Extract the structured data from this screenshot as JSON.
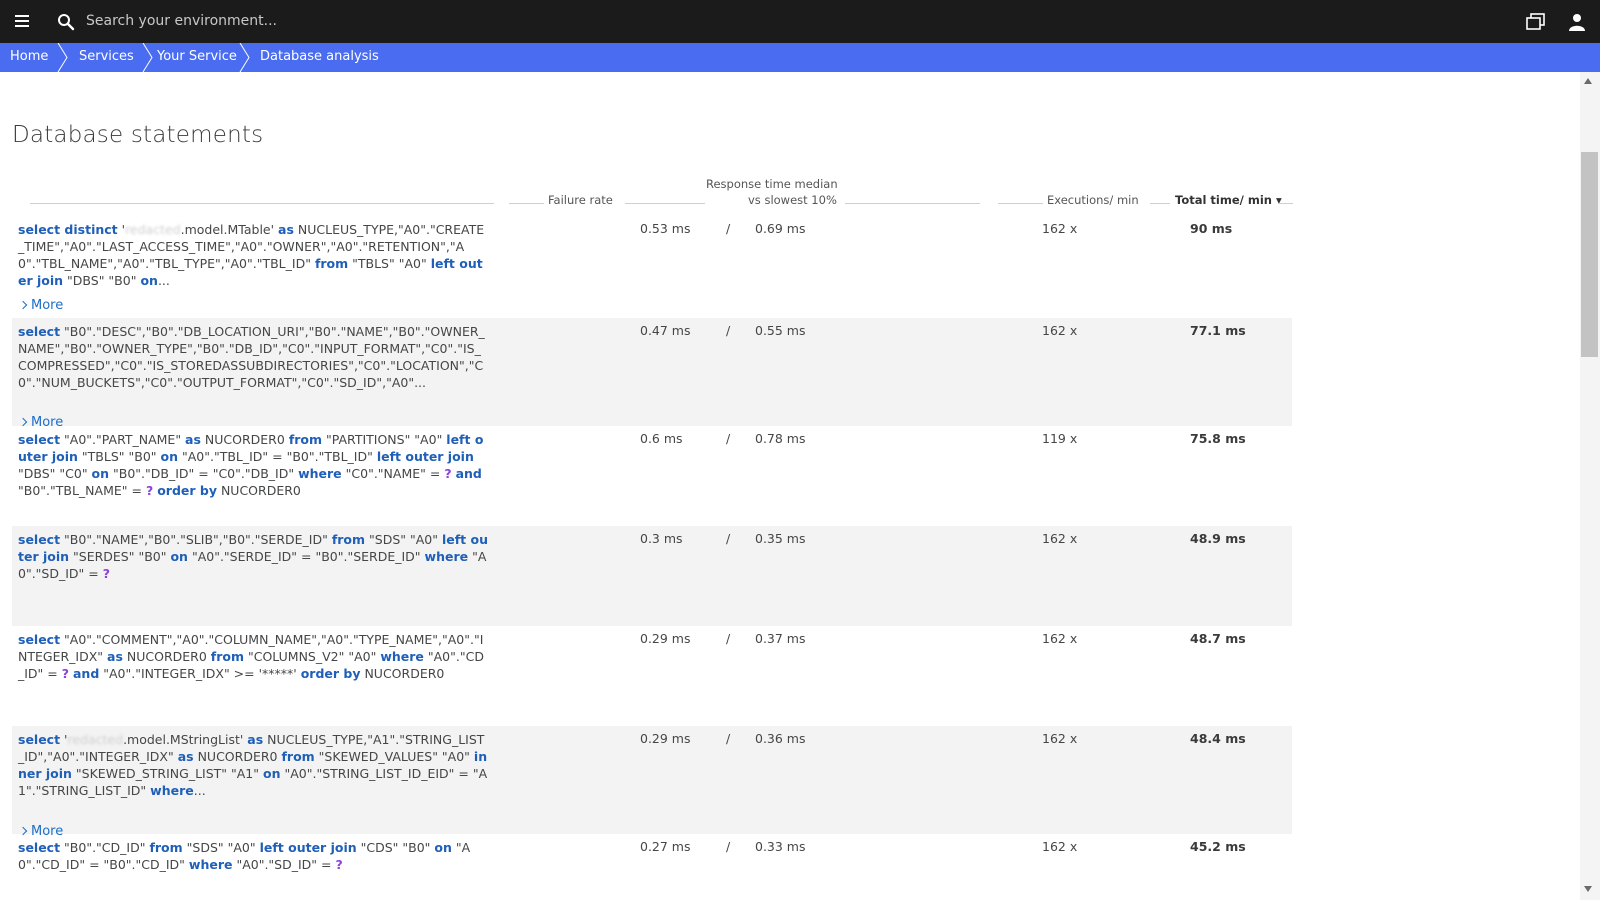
{
  "topbar": {
    "search_placeholder": "Search your environment..."
  },
  "breadcrumb": [
    "Home",
    "Services",
    "Your Service",
    "Database analysis"
  ],
  "page_title": "Database statements",
  "columns": {
    "failure_rate": "Failure rate",
    "response_line1": "Response time median",
    "response_line2": "vs slowest 10%",
    "executions": "Executions/ min",
    "total_time": "Total time/ min ▾"
  },
  "more_label": "More",
  "rows": [
    {
      "median": "0.53 ms",
      "sep": "/",
      "slowest": "0.69 ms",
      "executions": "162 x",
      "total": "90 ms"
    },
    {
      "median": "0.47 ms",
      "sep": "/",
      "slowest": "0.55 ms",
      "executions": "162 x",
      "total": "77.1 ms"
    },
    {
      "median": "0.6 ms",
      "sep": "/",
      "slowest": "0.78 ms",
      "executions": "119 x",
      "total": "75.8 ms"
    },
    {
      "median": "0.3 ms",
      "sep": "/",
      "slowest": "0.35 ms",
      "executions": "162 x",
      "total": "48.9 ms"
    },
    {
      "median": "0.29 ms",
      "sep": "/",
      "slowest": "0.37 ms",
      "executions": "162 x",
      "total": "48.7 ms"
    },
    {
      "median": "0.29 ms",
      "sep": "/",
      "slowest": "0.36 ms",
      "executions": "162 x",
      "total": "48.4 ms"
    },
    {
      "median": "0.27 ms",
      "sep": "/",
      "slowest": "0.33 ms",
      "executions": "162 x",
      "total": "45.2 ms"
    }
  ],
  "statements": [
    [
      {
        "t": "select distinct",
        "k": "kw"
      },
      {
        "t": " '"
      },
      {
        "t": "redacted",
        "k": "blur"
      },
      {
        "t": ".model.MTable' "
      },
      {
        "t": "as",
        "k": "kw"
      },
      {
        "t": " NUCLEUS_TYPE,\"A0\".\"CREATE_TIME\",\"A0\".\"LAST_ACCESS_TIME\",\"A0\".\"OWNER\",\"A0\".\"RETENTION\",\"A0\".\"TBL_NAME\",\"A0\".\"TBL_TYPE\",\"A0\".\"TBL_ID\" "
      },
      {
        "t": "from",
        "k": "kw"
      },
      {
        "t": " \"TBLS\" \"A0\" "
      },
      {
        "t": "left outer join",
        "k": "kw"
      },
      {
        "t": " \"DBS\" \"B0\" "
      },
      {
        "t": "on",
        "k": "kw"
      },
      {
        "t": "..."
      }
    ],
    [
      {
        "t": "select",
        "k": "kw"
      },
      {
        "t": " \"B0\".\"DESC\",\"B0\".\"DB_LOCATION_URI\",\"B0\".\"NAME\",\"B0\".\"OWNER_NAME\",\"B0\".\"OWNER_TYPE\",\"B0\".\"DB_ID\",\"C0\".\"INPUT_FORMAT\",\"C0\".\"IS_COMPRESSED\",\"C0\".\"IS_STOREDASSUBDIRECTORIES\",\"C0\".\"LOCATION\",\"C0\".\"NUM_BUCKETS\",\"C0\".\"OUTPUT_FORMAT\",\"C0\".\"SD_ID\",\"A0\"..."
      }
    ],
    [
      {
        "t": "select",
        "k": "kw"
      },
      {
        "t": " \"A0\".\"PART_NAME\" "
      },
      {
        "t": "as",
        "k": "kw"
      },
      {
        "t": " NUCORDER0 "
      },
      {
        "t": "from",
        "k": "kw"
      },
      {
        "t": " \"PARTITIONS\" \"A0\" "
      },
      {
        "t": "left outer join",
        "k": "kw"
      },
      {
        "t": " \"TBLS\" \"B0\" "
      },
      {
        "t": "on",
        "k": "kw"
      },
      {
        "t": " \"A0\".\"TBL_ID\" = \"B0\".\"TBL_ID\" "
      },
      {
        "t": "left outer join",
        "k": "kw"
      },
      {
        "t": " \"DBS\" \"C0\" "
      },
      {
        "t": "on",
        "k": "kw"
      },
      {
        "t": " \"B0\".\"DB_ID\" = \"C0\".\"DB_ID\" "
      },
      {
        "t": "where",
        "k": "kw"
      },
      {
        "t": " \"C0\".\"NAME\" = "
      },
      {
        "t": "?",
        "k": "op"
      },
      {
        "t": " "
      },
      {
        "t": "and",
        "k": "kw"
      },
      {
        "t": " \"B0\".\"TBL_NAME\" = "
      },
      {
        "t": "?",
        "k": "op"
      },
      {
        "t": " "
      },
      {
        "t": "order by",
        "k": "kw"
      },
      {
        "t": " NUCORDER0"
      }
    ],
    [
      {
        "t": "select",
        "k": "kw"
      },
      {
        "t": " \"B0\".\"NAME\",\"B0\".\"SLIB\",\"B0\".\"SERDE_ID\" "
      },
      {
        "t": "from",
        "k": "kw"
      },
      {
        "t": " \"SDS\" \"A0\" "
      },
      {
        "t": "left outer join",
        "k": "kw"
      },
      {
        "t": " \"SERDES\" \"B0\" "
      },
      {
        "t": "on",
        "k": "kw"
      },
      {
        "t": " \"A0\".\"SERDE_ID\" = \"B0\".\"SERDE_ID\" "
      },
      {
        "t": "where",
        "k": "kw"
      },
      {
        "t": " \"A0\".\"SD_ID\" = "
      },
      {
        "t": "?",
        "k": "op"
      }
    ],
    [
      {
        "t": "select",
        "k": "kw"
      },
      {
        "t": " \"A0\".\"COMMENT\",\"A0\".\"COLUMN_NAME\",\"A0\".\"TYPE_NAME\",\"A0\".\"INTEGER_IDX\" "
      },
      {
        "t": "as",
        "k": "kw"
      },
      {
        "t": " NUCORDER0 "
      },
      {
        "t": "from",
        "k": "kw"
      },
      {
        "t": " \"COLUMNS_V2\" \"A0\" "
      },
      {
        "t": "where",
        "k": "kw"
      },
      {
        "t": " \"A0\".\"CD_ID\" = "
      },
      {
        "t": "?",
        "k": "op"
      },
      {
        "t": " "
      },
      {
        "t": "and",
        "k": "kw"
      },
      {
        "t": " \"A0\".\"INTEGER_IDX\" >= '*****' "
      },
      {
        "t": "order by",
        "k": "kw"
      },
      {
        "t": " NUCORDER0"
      }
    ],
    [
      {
        "t": "select",
        "k": "kw"
      },
      {
        "t": " '"
      },
      {
        "t": "redacted",
        "k": "blur"
      },
      {
        "t": ".model.MStringList' "
      },
      {
        "t": "as",
        "k": "kw"
      },
      {
        "t": " NUCLEUS_TYPE,\"A1\".\"STRING_LIST_ID\",\"A0\".\"INTEGER_IDX\" "
      },
      {
        "t": "as",
        "k": "kw"
      },
      {
        "t": " NUCORDER0 "
      },
      {
        "t": "from",
        "k": "kw"
      },
      {
        "t": " \"SKEWED_VALUES\" \"A0\" "
      },
      {
        "t": "inner join",
        "k": "kw"
      },
      {
        "t": " \"SKEWED_STRING_LIST\" \"A1\" "
      },
      {
        "t": "on",
        "k": "kw"
      },
      {
        "t": " \"A0\".\"STRING_LIST_ID_EID\" = \"A1\".\"STRING_LIST_ID\" "
      },
      {
        "t": "where",
        "k": "kw"
      },
      {
        "t": "..."
      }
    ],
    [
      {
        "t": "select",
        "k": "kw"
      },
      {
        "t": " \"B0\".\"CD_ID\" "
      },
      {
        "t": "from",
        "k": "kw"
      },
      {
        "t": " \"SDS\" \"A0\" "
      },
      {
        "t": "left outer join",
        "k": "kw"
      },
      {
        "t": " \"CDS\" \"B0\" "
      },
      {
        "t": "on",
        "k": "kw"
      },
      {
        "t": " \"A0\".\"CD_ID\" = \"B0\".\"CD_ID\" "
      },
      {
        "t": "where",
        "k": "kw"
      },
      {
        "t": " \"A0\".\"SD_ID\" = "
      },
      {
        "t": "?",
        "k": "op"
      }
    ]
  ]
}
